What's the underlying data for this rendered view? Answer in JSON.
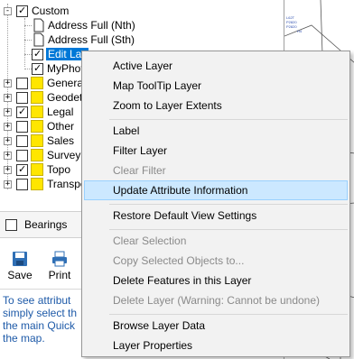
{
  "tree": {
    "items": [
      {
        "label": "Custom",
        "kind": "folder-root",
        "checked": true
      },
      {
        "label": "Address Full (Nth)",
        "kind": "layer",
        "checked": false
      },
      {
        "label": "Address Full (Sth)",
        "kind": "layer",
        "checked": false
      },
      {
        "label": "Edit Lay",
        "kind": "layer",
        "checked": true,
        "selected": true
      },
      {
        "label": "MyPhot",
        "kind": "layer",
        "checked": true
      },
      {
        "label": "General Bdy",
        "kind": "group",
        "checked": false
      },
      {
        "label": "Geodetic",
        "kind": "group",
        "checked": false
      },
      {
        "label": "Legal",
        "kind": "group",
        "checked": true
      },
      {
        "label": "Other",
        "kind": "group",
        "checked": false
      },
      {
        "label": "Sales",
        "kind": "group",
        "checked": false
      },
      {
        "label": "Survey",
        "kind": "group",
        "checked": false
      },
      {
        "label": "Topo",
        "kind": "group",
        "checked": true
      },
      {
        "label": "Transport",
        "kind": "group",
        "checked": false
      }
    ],
    "expander_plus": "+",
    "expander_minus": "-"
  },
  "bearings": {
    "label": "Bearings",
    "checked": false
  },
  "toolbar": {
    "save_label": "Save",
    "print_label": "Print"
  },
  "help": {
    "lines": [
      "To see attribut",
      "simply select th",
      "the main Quick",
      "the map."
    ]
  },
  "map": {
    "tiny_labels": [
      "L62T",
      "P2820",
      "P2820",
      "H4"
    ]
  },
  "context_menu": {
    "items": [
      {
        "label": "Active Layer",
        "enabled": true
      },
      {
        "label": "Map ToolTip Layer",
        "enabled": true
      },
      {
        "label": "Zoom to Layer Extents",
        "enabled": true
      },
      {
        "label": "Label",
        "enabled": true
      },
      {
        "label": "Filter Layer",
        "enabled": true
      },
      {
        "label": "Clear Filter",
        "enabled": false
      },
      {
        "label": "Update Attribute Information",
        "enabled": true,
        "highlighted": true
      },
      {
        "label": "Restore Default View Settings",
        "enabled": true
      },
      {
        "label": "Clear Selection",
        "enabled": false
      },
      {
        "label": "Copy Selected Objects to...",
        "enabled": false
      },
      {
        "label": "Delete Features in this Layer",
        "enabled": true
      },
      {
        "label": "Delete Layer (Warning: Cannot be undone)",
        "enabled": false
      },
      {
        "label": "Browse Layer Data",
        "enabled": true
      },
      {
        "label": "Layer Properties",
        "enabled": true
      }
    ]
  },
  "colors": {
    "selection": "#0078d7",
    "menu_hover": "#cce8ff",
    "help_text": "#1e5aa8",
    "folder": "#ffe600"
  }
}
